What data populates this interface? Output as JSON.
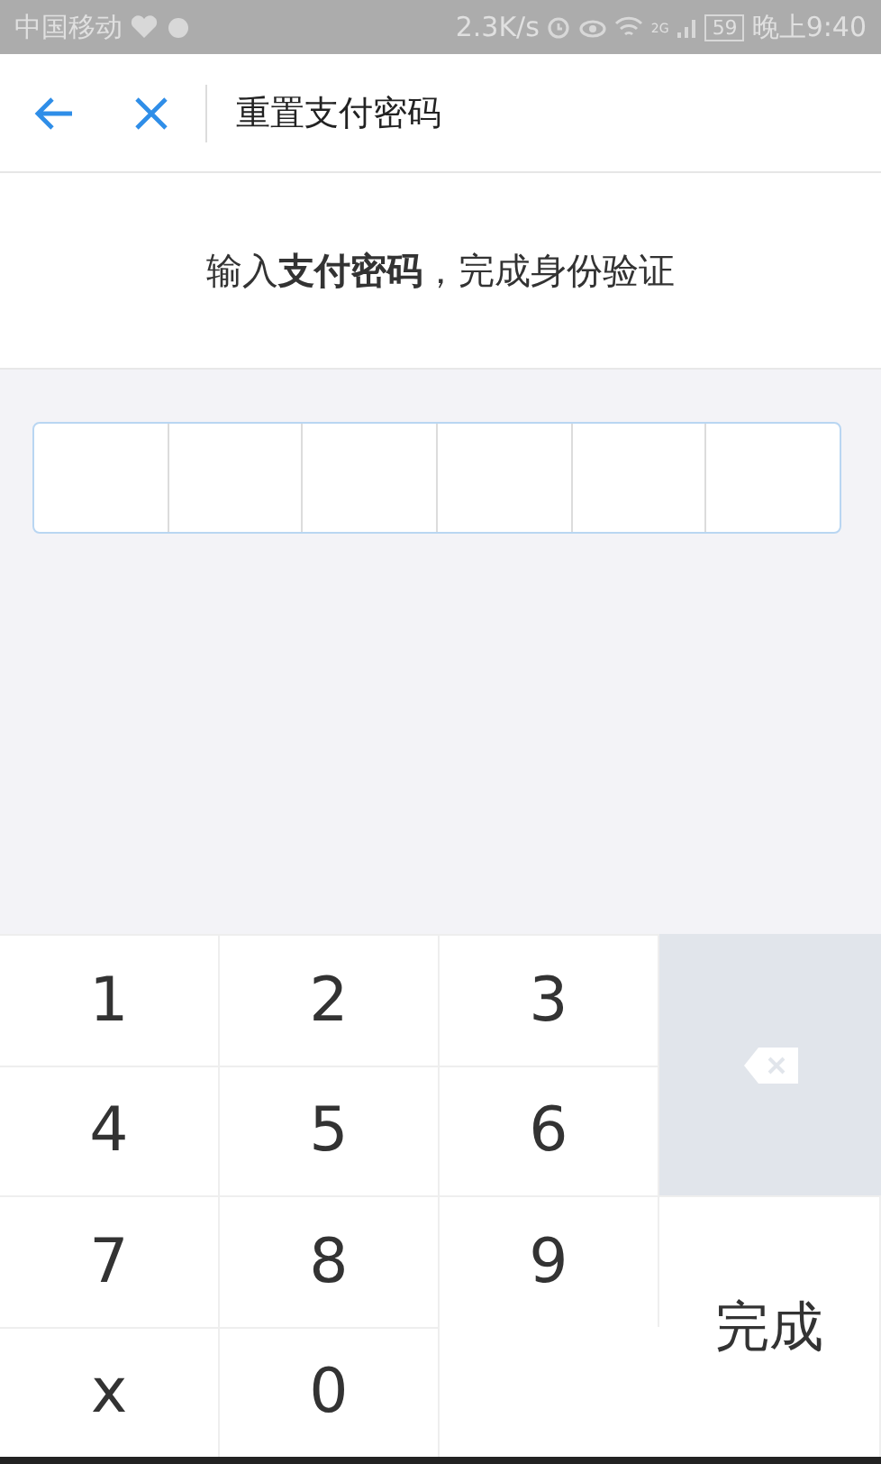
{
  "status_bar": {
    "carrier": "中国移动",
    "network_speed": "2.3K/s",
    "network_type": "2G",
    "battery": "59",
    "time": "晚上9:40"
  },
  "nav": {
    "title": "重置支付密码"
  },
  "prompt": "输入**支付密码**，完成身份验证",
  "password_cells": [
    {
      "filled": false
    },
    {
      "filled": false
    },
    {
      "filled": false
    },
    {
      "filled": false
    },
    {
      "filled": false
    },
    {
      "filled": false
    }
  ],
  "keypad": [
    {
      "kind": "digit",
      "label": "1"
    },
    {
      "kind": "digit",
      "label": "2"
    },
    {
      "kind": "digit",
      "label": "3"
    },
    {
      "kind": "delete"
    },
    {
      "kind": "digit",
      "label": "4"
    },
    {
      "kind": "digit",
      "label": "5"
    },
    {
      "kind": "digit",
      "label": "6"
    },
    {
      "kind": "digit",
      "label": "7"
    },
    {
      "kind": "digit",
      "label": "8"
    },
    {
      "kind": "digit",
      "label": "9"
    },
    {
      "kind": "done",
      "label": "完成"
    },
    {
      "kind": "digit",
      "label": "x"
    },
    {
      "kind": "digit",
      "label": "0"
    }
  ]
}
